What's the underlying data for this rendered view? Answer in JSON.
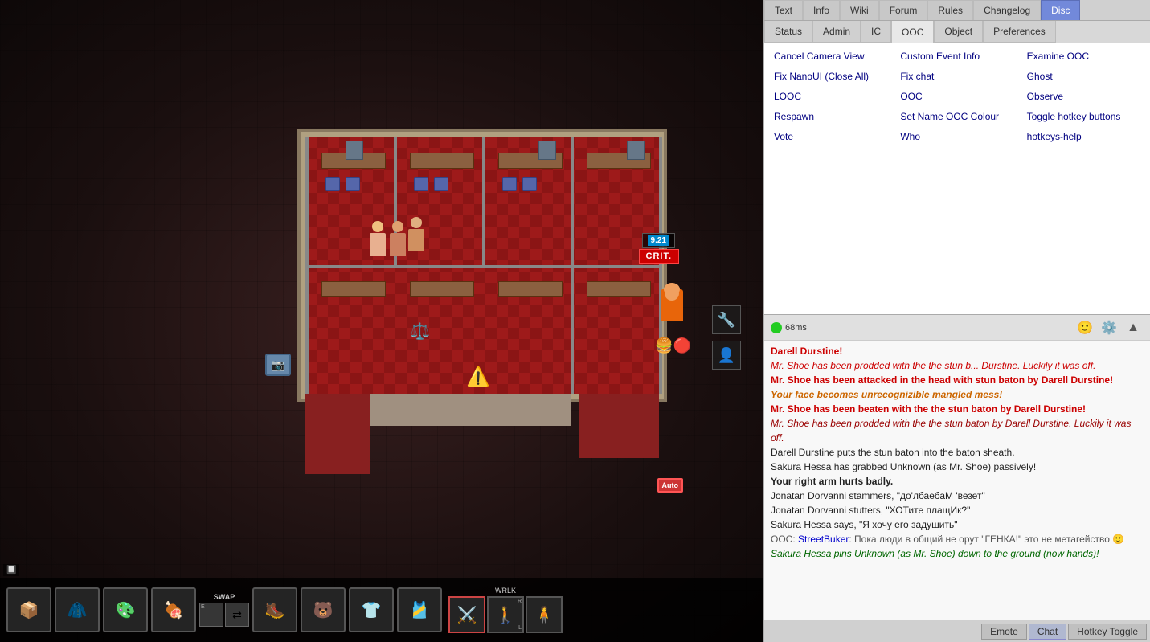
{
  "top_tabs": {
    "items": [
      {
        "label": "Text",
        "active": false
      },
      {
        "label": "Info",
        "active": false
      },
      {
        "label": "Wiki",
        "active": false
      },
      {
        "label": "Forum",
        "active": false
      },
      {
        "label": "Rules",
        "active": false
      },
      {
        "label": "Changelog",
        "active": false
      },
      {
        "label": "Disc",
        "active": true,
        "style": "disc"
      }
    ]
  },
  "status_tabs": {
    "items": [
      {
        "label": "Status",
        "active": false
      },
      {
        "label": "Admin",
        "active": false
      },
      {
        "label": "IC",
        "active": false
      },
      {
        "label": "OOC",
        "active": true
      },
      {
        "label": "Object",
        "active": false
      },
      {
        "label": "Preferences",
        "active": false
      }
    ]
  },
  "menu_items": [
    {
      "label": "Cancel Camera View",
      "col": 1
    },
    {
      "label": "Custom Event Info",
      "col": 2
    },
    {
      "label": "Examine OOC",
      "col": 3
    },
    {
      "label": "Fix NanoUI (Close All)",
      "col": 1
    },
    {
      "label": "Fix chat",
      "col": 2
    },
    {
      "label": "Ghost",
      "col": 3
    },
    {
      "label": "LOOC",
      "col": 1
    },
    {
      "label": "OOC",
      "col": 2
    },
    {
      "label": "Observe",
      "col": 3
    },
    {
      "label": "Respawn",
      "col": 1
    },
    {
      "label": "Set Name OOC Colour",
      "col": 2
    },
    {
      "label": "Toggle hotkey buttons",
      "col": 3
    },
    {
      "label": "Vote",
      "col": 1
    },
    {
      "label": "Who",
      "col": 2
    },
    {
      "label": "hotkeys-help",
      "col": 3
    }
  ],
  "chat": {
    "ping": "68ms",
    "messages": [
      {
        "text": "Darell Durstine!",
        "class": "msg-red-bold"
      },
      {
        "text": "Mr. Shoe has been prodded with the the stun b... Durstine. Luckily it was off.",
        "class": "msg-red-italic"
      },
      {
        "text": "Mr. Shoe has been attacked in the head with stun baton by Darell Durstine!",
        "class": "msg-red-bold"
      },
      {
        "text": "Your face becomes unrecognizible mangled mess!",
        "class": "msg-orange-bold-italic"
      },
      {
        "text": "Mr. Shoe has been beaten with the the stun baton by Darell Durstine!",
        "class": "msg-red-bold"
      },
      {
        "text": "Mr. Shoe has been prodded with the the stun baton by Darell Durstine. Luckily it was off.",
        "class": "msg-dark-red-italic"
      },
      {
        "text": "Darell Durstine puts the stun baton into the baton sheath.",
        "class": "msg-normal"
      },
      {
        "text": "Sakura Hessa has grabbed Unknown (as Mr. Shoe) passively!",
        "class": "msg-normal"
      },
      {
        "text": "Your right arm hurts badly.",
        "class": "msg-bold"
      },
      {
        "text": "Jonatan Dorvanni stammers, \"до'лбаебаМ 'везет\"",
        "class": "msg-normal"
      },
      {
        "text": "Jonatan Dorvanni stutters, \"ХОТите плащИк?\"",
        "class": "msg-normal"
      },
      {
        "text": "Sakura Hessa says, \"Я хочу его задушить\"",
        "class": "msg-normal"
      },
      {
        "text": "OOC: StreetBuker: Пока люди в общий не орут \"ГЕНКА!\" это не метагейство 🙂",
        "class": "msg-ooc",
        "ooc_link": "StreetBuker"
      },
      {
        "text": "Sakura Hessa pins Unknown (as Mr. Shoe) down to the ground (now hands)!",
        "class": "msg-green-italic"
      }
    ]
  },
  "bottom_buttons": [
    {
      "label": "Emote"
    },
    {
      "label": "Chat",
      "active": true
    },
    {
      "label": "Hotkey Toggle"
    }
  ],
  "toolbar": {
    "slots": [
      {
        "icon": "📦",
        "label": ""
      },
      {
        "icon": "🧥",
        "label": ""
      },
      {
        "icon": "🎨",
        "label": ""
      },
      {
        "icon": "🍖",
        "label": ""
      },
      {
        "icon": "🥾",
        "label": ""
      },
      {
        "icon": "🐻",
        "label": ""
      },
      {
        "icon": "👕",
        "label": ""
      },
      {
        "icon": "🎽",
        "label": ""
      }
    ],
    "swap_label": "SWAP",
    "walk_label": "WRLK",
    "keybind_e": "E",
    "keybind_r": "R",
    "keybind_l": "L"
  },
  "hud": {
    "health_value": "9.21",
    "crit_text": "CRIT.",
    "auto_text": "Auto"
  }
}
